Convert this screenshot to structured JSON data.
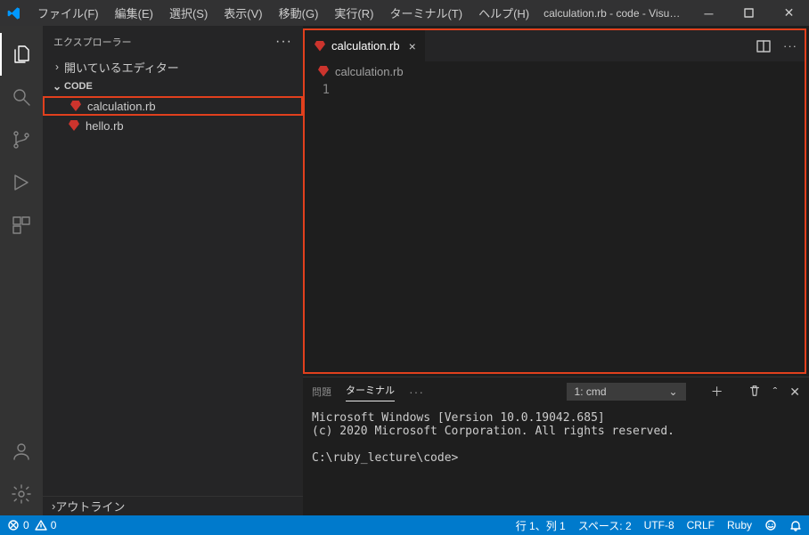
{
  "titlebar": {
    "menus": [
      "ファイル(F)",
      "編集(E)",
      "選択(S)",
      "表示(V)",
      "移動(G)",
      "実行(R)",
      "ターミナル(T)",
      "ヘルプ(H)"
    ],
    "window_title": "calculation.rb - code - Visual Studio C..."
  },
  "sidebar": {
    "title": "エクスプローラー",
    "open_editors_label": "開いているエディター",
    "workspace_label": "CODE",
    "files": [
      {
        "name": "calculation.rb",
        "highlight": true
      },
      {
        "name": "hello.rb",
        "highlight": false
      }
    ],
    "outline_label": "アウトライン"
  },
  "editor": {
    "tab_label": "calculation.rb",
    "breadcrumb": "calculation.rb",
    "gutter_line": "1"
  },
  "panel": {
    "tabs": {
      "problems": "問題",
      "terminal": "ターミナル"
    },
    "terminal_selector": "1: cmd",
    "terminal_lines": [
      "Microsoft Windows [Version 10.0.19042.685]",
      "(c) 2020 Microsoft Corporation. All rights reserved.",
      "",
      "C:\\ruby_lecture\\code>"
    ]
  },
  "statusbar": {
    "errors": "0",
    "warnings": "0",
    "line_col": "行 1、列 1",
    "spaces": "スペース: 2",
    "encoding": "UTF-8",
    "eol": "CRLF",
    "language": "Ruby"
  }
}
